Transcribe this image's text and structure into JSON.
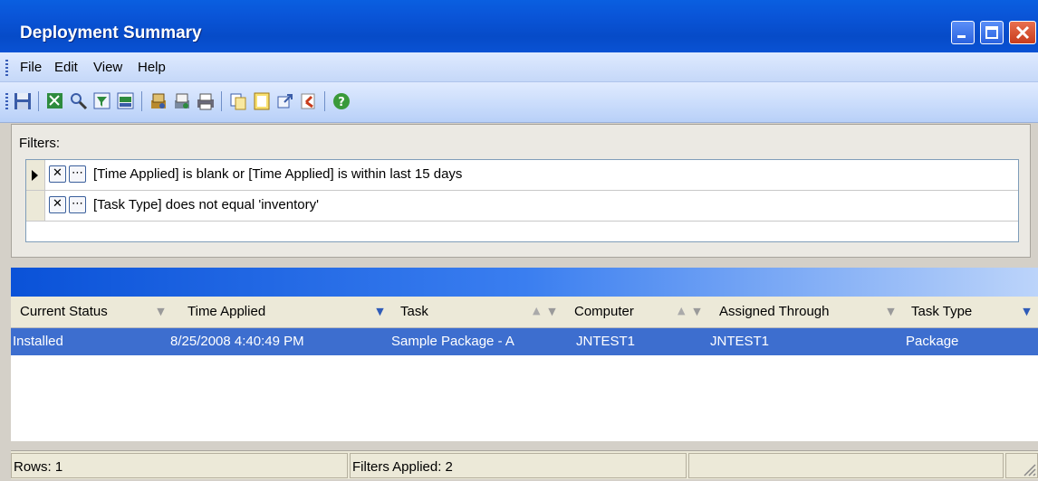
{
  "window": {
    "title": "Deployment Summary"
  },
  "menu": {
    "items": [
      "File",
      "Edit",
      "View",
      "Help"
    ]
  },
  "toolbar": {
    "icons": [
      "save-icon",
      "export-icon",
      "find-icon",
      "filter-icon",
      "xml-icon",
      "deploy-icon",
      "report-icon",
      "print-icon",
      "copy-icon",
      "properties-icon",
      "open-icon",
      "undo-icon",
      "help-icon"
    ]
  },
  "filters": {
    "label": "Filters:",
    "rows": [
      {
        "remove": "✕",
        "edit": "⋯",
        "text": "[Time Applied] is blank or [Time Applied] is within last 15 days"
      },
      {
        "remove": "✕",
        "edit": "⋯",
        "text": "[Task Type] does not equal 'inventory'"
      }
    ]
  },
  "grid": {
    "columns": [
      "Current Status",
      "Time Applied",
      "Task",
      "Computer",
      "Assigned Through",
      "Task Type"
    ],
    "rows": [
      {
        "cells": [
          "Installed",
          "8/25/2008 4:40:49 PM",
          "Sample Package - A",
          "JNTEST1",
          "JNTEST1",
          "Package"
        ]
      }
    ]
  },
  "status": {
    "rows": "Rows: 1",
    "filters_applied": "Filters Applied: 2"
  }
}
